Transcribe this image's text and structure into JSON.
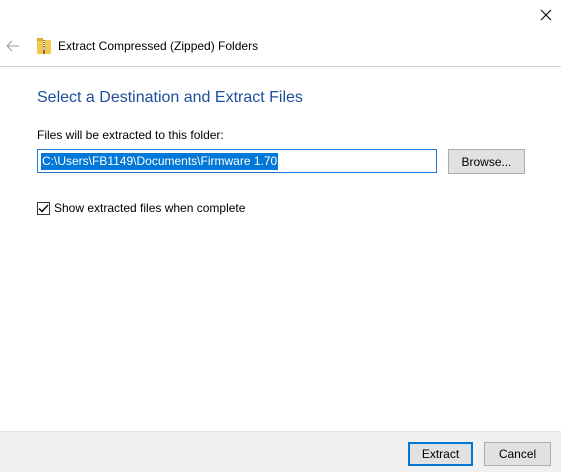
{
  "window": {
    "close_icon": "close-icon",
    "back_icon": "back-arrow-icon"
  },
  "header": {
    "title": "Extract Compressed (Zipped) Folders",
    "icon": "zip-folder-icon"
  },
  "main": {
    "heading": "Select a Destination and Extract Files",
    "folder_label": "Files will be extracted to this folder:",
    "path_value": "C:\\Users\\FB1149\\Documents\\Firmware 1.70",
    "browse_label": "Browse...",
    "show_files_label": "Show extracted files when complete",
    "show_files_checked": true
  },
  "footer": {
    "extract_label": "Extract",
    "cancel_label": "Cancel"
  },
  "colors": {
    "heading": "#1e4e9b",
    "selection": "#0078d7",
    "footer_bg": "#f0f0f0"
  }
}
